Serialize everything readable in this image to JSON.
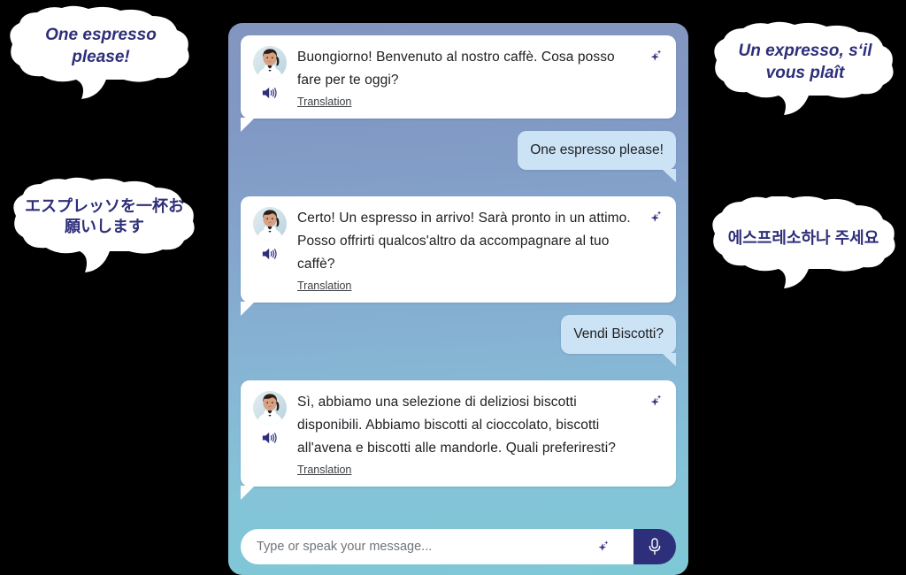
{
  "colors": {
    "panel_top": "#8295bf",
    "panel_bottom": "#7ec8d6",
    "bot_bubble": "#ffffff",
    "user_bubble": "#cce3f6",
    "accent_indigo": "#2e2f7a",
    "text_primary": "#202124",
    "callout_text": "#2e2f7a",
    "page_background": "#000000"
  },
  "chat": {
    "messages": [
      {
        "role": "bot",
        "text": "Buongiorno! Benvenuto al nostro caffè. Cosa posso fare per te oggi?",
        "translation_label": "Translation",
        "speaker_icon": "speaker-icon",
        "sparkle_icon": "sparkle-icon",
        "avatar_icon": "avatar"
      },
      {
        "role": "user",
        "text": "One espresso please!"
      },
      {
        "role": "bot",
        "text": "Certo! Un espresso in arrivo! Sarà pronto in un attimo. Posso offrirti qualcos'altro da accompagnare al tuo caffè?",
        "translation_label": "Translation",
        "speaker_icon": "speaker-icon",
        "sparkle_icon": "sparkle-icon",
        "avatar_icon": "avatar"
      },
      {
        "role": "user",
        "text": "Vendi Biscotti?"
      },
      {
        "role": "bot",
        "text": "Sì, abbiamo una selezione di deliziosi biscotti disponibili. Abbiamo biscotti al cioccolato, biscotti all'avena e biscotti alle mandorle. Quali preferiresti?",
        "translation_label": "Translation",
        "speaker_icon": "speaker-icon",
        "sparkle_icon": "sparkle-icon",
        "avatar_icon": "avatar"
      }
    ]
  },
  "composer": {
    "placeholder": "Type or speak your message...",
    "value": "",
    "sparkle_icon": "sparkle-icon",
    "mic_icon": "microphone-icon"
  },
  "callouts": [
    {
      "id": "espresso",
      "text": "One espresso please!",
      "language": "English",
      "side": "left"
    },
    {
      "id": "japanese",
      "text": "エスプレッソを一杯お願いします",
      "language": "Japanese",
      "side": "left"
    },
    {
      "id": "french",
      "text": "Un expresso, s‘il vous plaît",
      "language": "French",
      "side": "right"
    },
    {
      "id": "korean",
      "text": "에스프레소하나 주세요",
      "language": "Korean",
      "side": "right"
    }
  ]
}
